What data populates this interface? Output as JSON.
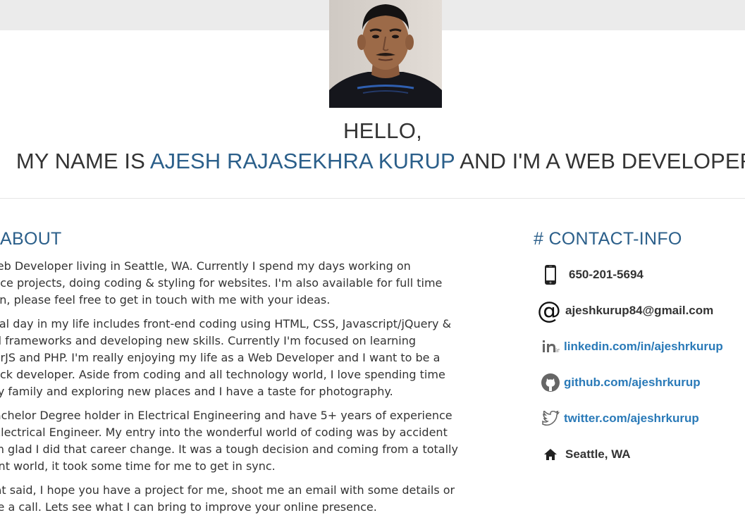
{
  "colors": {
    "accent": "#2b5f8a",
    "link": "#2a7ab8",
    "text": "#333333",
    "top_band": "#ebebeb"
  },
  "hero": {
    "greeting": "HELLO,",
    "name_prefix": "MY NAME IS ",
    "name": "AJESH RAJASEKHRA KURUP",
    "name_suffix": " AND I'M A WEB DEVELOPER"
  },
  "about": {
    "title": "ABOUT",
    "paragraphs": [
      [
        "a Web Developer living in Seattle, WA. Currently I spend my days working on",
        "elance projects, doing coding & styling for websites. I'm also available for full time",
        "sition, please feel free to get in touch with me with your ideas."
      ],
      [
        "ypical day in my life includes front-end coding using HTML, CSS, Javascript/jQuery &",
        "ated frameworks and developing new skills. Currently I'm focused on learning",
        "gularJS and PHP. I'm really enjoying my life as a Web Developer and I want to be a",
        "l stack developer. Aside from coding and all technology world, I love spending time",
        "h my family and exploring new places and I have a taste for photography."
      ],
      [
        "a Bachelor Degree holder in Electrical Engineering and have 5+ years of experience",
        "an Electrical Engineer. My entry into the wonderful world of coding was by accident",
        "d I'm glad I did that career change. It was a tough decision and coming from a totally",
        "ferent world, it took some time for me to get in sync."
      ],
      [
        ", that said, I hope you have a project for me, shoot me an email with some details or",
        "e me a call. Lets see what I can bring to improve your online presence."
      ]
    ]
  },
  "contact": {
    "title": "# CONTACT-INFO",
    "items": [
      {
        "icon": "phone-icon",
        "text": "650-201-5694",
        "link": false
      },
      {
        "icon": "at-sign-icon",
        "text": "ajeshkurup84@gmail.com",
        "link": false
      },
      {
        "icon": "linkedin-icon",
        "text": "linkedin.com/in/ajeshrkurup",
        "link": true
      },
      {
        "icon": "github-icon",
        "text": "github.com/ajeshrkurup",
        "link": true
      },
      {
        "icon": "twitter-icon",
        "text": "twitter.com/ajeshrkurup",
        "link": true
      },
      {
        "icon": "home-icon",
        "text": "Seattle, WA",
        "link": false
      }
    ]
  }
}
